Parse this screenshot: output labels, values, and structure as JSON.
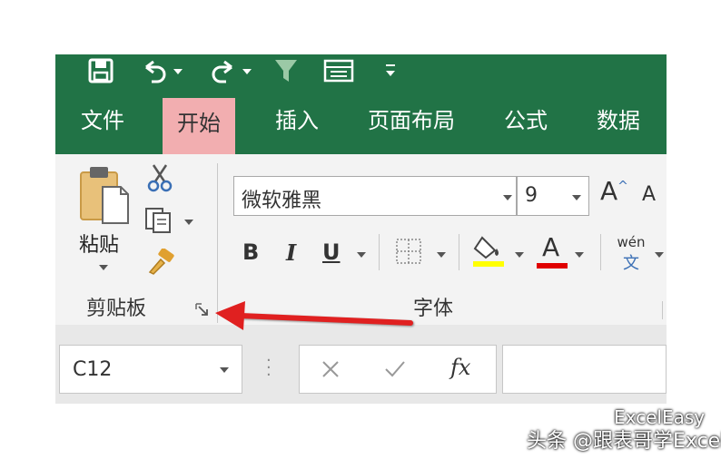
{
  "tabs": [
    {
      "label": "文件",
      "active": false
    },
    {
      "label": "开始",
      "active": true
    },
    {
      "label": "插入",
      "active": false
    },
    {
      "label": "页面布局",
      "active": false
    },
    {
      "label": "公式",
      "active": false
    },
    {
      "label": "数据",
      "active": false
    }
  ],
  "clipboard": {
    "paste_label": "粘贴",
    "group_label": "剪贴板"
  },
  "font": {
    "name": "微软雅黑",
    "size": "9",
    "group_label": "字体",
    "bold": "B",
    "italic": "I",
    "underline": "U",
    "grow": "A",
    "shrink": "A",
    "phonetic_top": "wén",
    "phonetic_bottom": "文",
    "font_color_glyph": "A"
  },
  "formula_bar": {
    "name_box": "C12",
    "fx": "fx"
  },
  "watermark": {
    "brand": "ExcelEasy",
    "text": "头条 @跟表哥学Excel"
  },
  "colors": {
    "ribbon_green": "#217346",
    "active_tab": "#f2aeb0",
    "fill_yellow": "#ffff00",
    "font_red": "#e00000",
    "arrow": "#e02020"
  },
  "icons": [
    "save-icon",
    "undo-icon",
    "redo-icon",
    "filter-icon",
    "form-icon",
    "qat-more-icon",
    "paste-icon",
    "cut-icon",
    "copy-icon",
    "format-painter-icon",
    "dialog-launcher-icon",
    "border-icon",
    "fill-color-icon",
    "cancel-icon",
    "enter-icon"
  ]
}
